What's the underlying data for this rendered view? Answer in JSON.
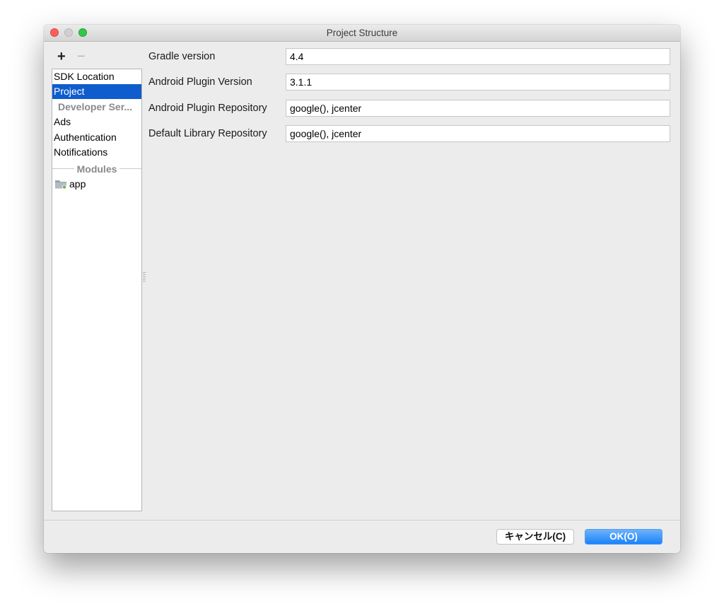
{
  "window": {
    "title": "Project Structure"
  },
  "toolbar": {
    "add_label": "+",
    "remove_label": "−"
  },
  "sidebar": {
    "items": [
      {
        "label": "SDK Location",
        "selected": false
      },
      {
        "label": "Project",
        "selected": true
      },
      {
        "label": "Developer Ser...",
        "type": "header"
      },
      {
        "label": "Ads",
        "selected": false
      },
      {
        "label": "Authentication",
        "selected": false
      },
      {
        "label": "Notifications",
        "selected": false
      }
    ],
    "modules_header": "Modules",
    "modules": [
      {
        "label": "app",
        "icon": "module-folder-icon"
      }
    ]
  },
  "form": {
    "fields": [
      {
        "label": "Gradle version",
        "value": "4.4"
      },
      {
        "label": "Android Plugin Version",
        "value": "3.1.1"
      },
      {
        "label": "Android Plugin Repository",
        "value": "google(), jcenter"
      },
      {
        "label": "Default Library Repository",
        "value": "google(), jcenter"
      }
    ]
  },
  "buttons": {
    "cancel_label": "キャンセル(C)",
    "ok_label": "OK(O)"
  },
  "colors": {
    "selection": "#0f5ccd",
    "ok_button": "#1a82fb",
    "close": "#fc605c",
    "maximize": "#34c84a"
  }
}
